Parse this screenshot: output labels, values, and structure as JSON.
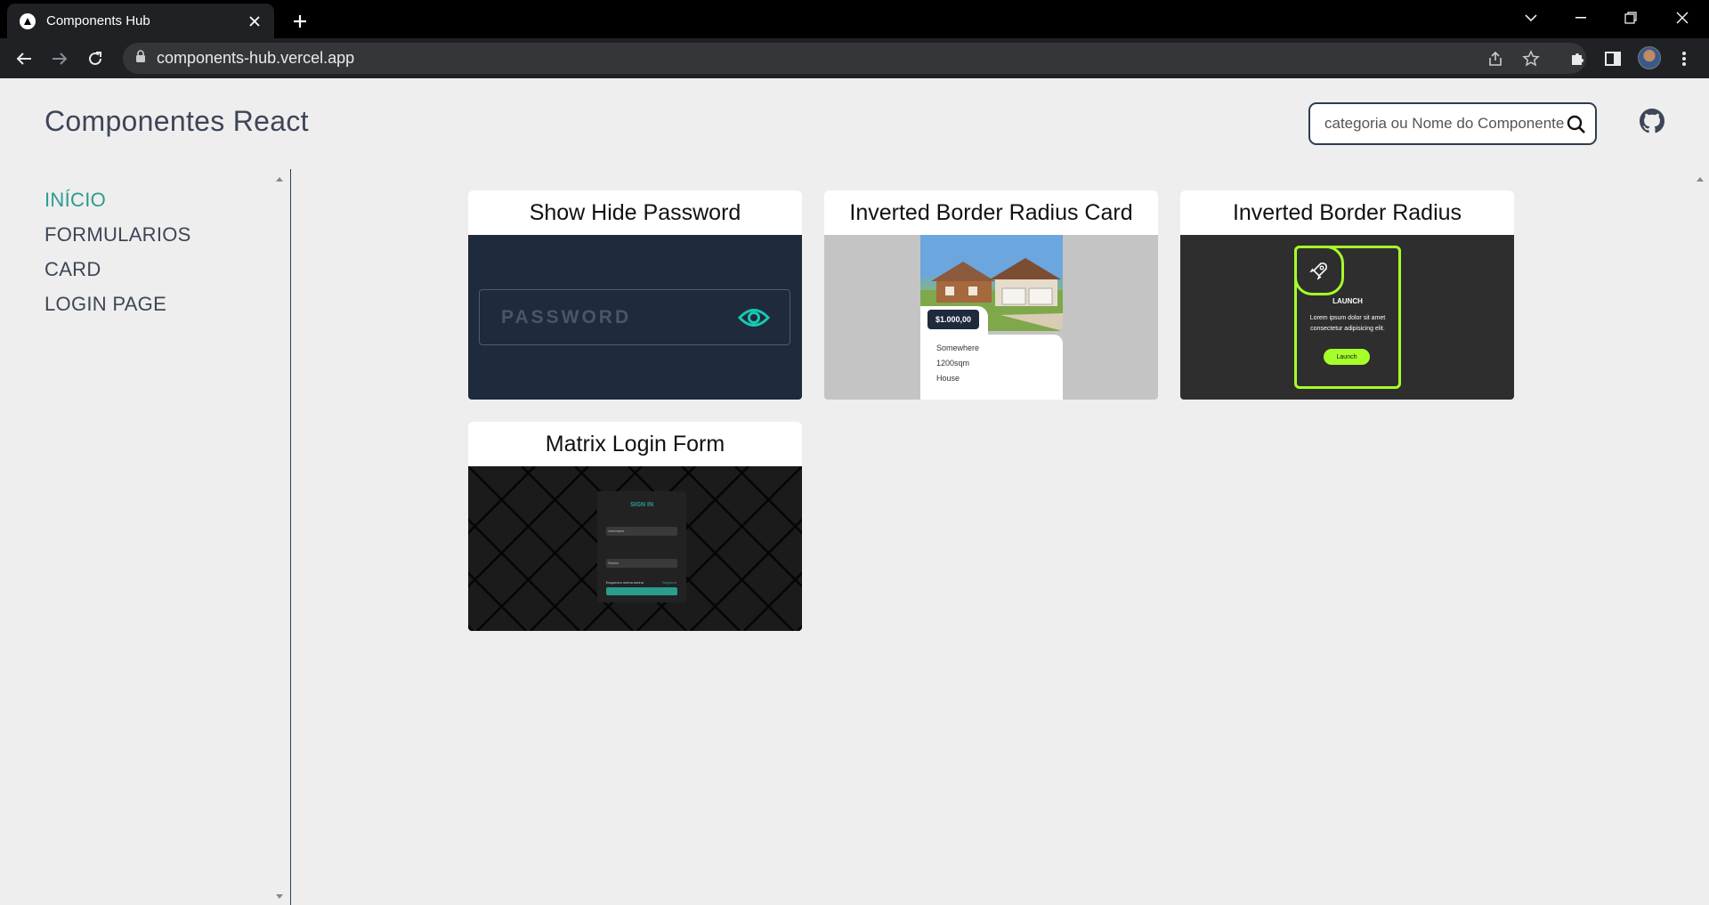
{
  "browser": {
    "tab_title": "Components Hub",
    "url": "components-hub.vercel.app"
  },
  "header": {
    "title": "Componentes React",
    "search_placeholder": "categoria ou Nome do Componente"
  },
  "sidebar": {
    "items": [
      {
        "label": "INÍCIO",
        "active": true
      },
      {
        "label": "FORMULARIOS",
        "active": false
      },
      {
        "label": "CARD",
        "active": false
      },
      {
        "label": "LOGIN PAGE",
        "active": false
      }
    ]
  },
  "cards": [
    {
      "title": "Show Hide Password",
      "preview": {
        "placeholder": "PASSWORD"
      }
    },
    {
      "title": "Inverted Border Radius Card",
      "preview": {
        "price": "$1.000,00",
        "lines": [
          "Somewhere",
          "1200sqm",
          "House"
        ]
      }
    },
    {
      "title": "Inverted Border Radius",
      "preview": {
        "heading": "LAUNCH",
        "body": "Lorem ipsum dolor sit amet consectetur adipisicing elit.",
        "button": "Launch"
      }
    },
    {
      "title": "Matrix Login Form",
      "preview": {
        "heading": "SIGN IN",
        "field1": "Username",
        "field2": "Senha",
        "remember": "Esqueceu minha senha",
        "signup": "Registrar",
        "button": "Entrar"
      }
    }
  ],
  "colors": {
    "accent": "#2a9d8f",
    "text": "#3d4656",
    "page_bg": "#eeeeee",
    "lime": "#a6ff2a"
  }
}
